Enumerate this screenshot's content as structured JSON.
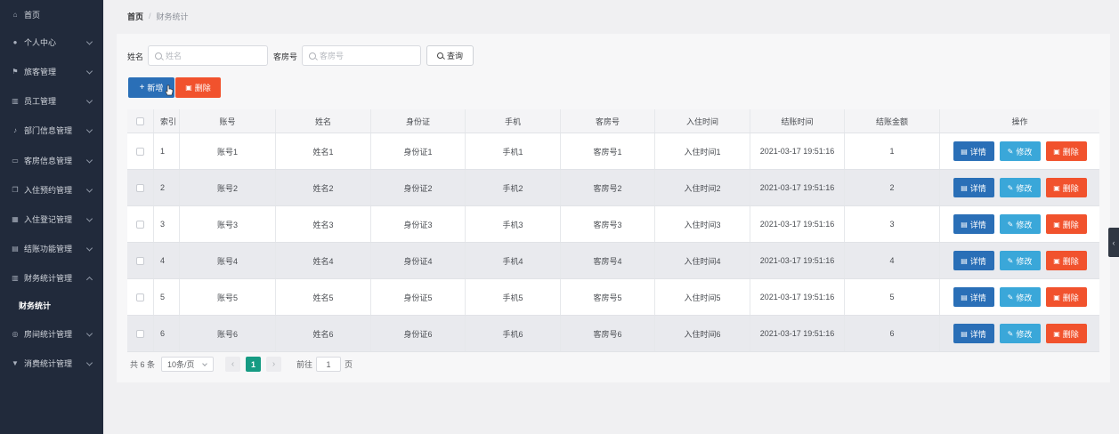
{
  "sidebar": {
    "items": [
      {
        "label": "首页",
        "icon": "home-icon",
        "glyph": "⌂",
        "expandable": false
      },
      {
        "label": "个人中心",
        "icon": "user-icon",
        "glyph": "●",
        "expandable": true
      },
      {
        "label": "旅客管理",
        "icon": "flag-icon",
        "glyph": "⚑",
        "expandable": true
      },
      {
        "label": "员工管理",
        "icon": "chart-bars-icon",
        "glyph": "▥",
        "expandable": true
      },
      {
        "label": "部门信息管理",
        "icon": "microphone-icon",
        "glyph": "♪",
        "expandable": true
      },
      {
        "label": "客房信息管理",
        "icon": "message-icon",
        "glyph": "▭",
        "expandable": true
      },
      {
        "label": "入住预约管理",
        "icon": "copy-icon",
        "glyph": "❐",
        "expandable": true
      },
      {
        "label": "入住登记管理",
        "icon": "grid-icon",
        "glyph": "▦",
        "expandable": true
      },
      {
        "label": "结账功能管理",
        "icon": "bag-icon",
        "glyph": "▤",
        "expandable": true
      },
      {
        "label": "财务统计管理",
        "icon": "trash-icon",
        "glyph": "▥",
        "expandable": true,
        "expanded": true
      },
      {
        "label": "房间统计管理",
        "icon": "globe-icon",
        "glyph": "◎",
        "expandable": true
      },
      {
        "label": "消费统计管理",
        "icon": "cup-icon",
        "glyph": "▼",
        "expandable": true
      }
    ],
    "sub_item": "财务统计"
  },
  "breadcrumb": {
    "home": "首页",
    "separator": "/",
    "current": "财务统计"
  },
  "search": {
    "name_label": "姓名",
    "name_placeholder": "姓名",
    "room_label": "客房号",
    "room_placeholder": "客房号",
    "query_label": "查询"
  },
  "actions": {
    "add_label": "新增",
    "delete_label": "删除"
  },
  "table": {
    "headers": [
      "索引",
      "账号",
      "姓名",
      "身份证",
      "手机",
      "客房号",
      "入住时间",
      "结账时间",
      "结账金额",
      "操作"
    ],
    "rows": [
      {
        "index": "1",
        "account": "账号1",
        "name": "姓名1",
        "idcard": "身份证1",
        "phone": "手机1",
        "room": "客房号1",
        "checkin": "入住时间1",
        "checkout": "2021-03-17 19:51:16",
        "amount": "1"
      },
      {
        "index": "2",
        "account": "账号2",
        "name": "姓名2",
        "idcard": "身份证2",
        "phone": "手机2",
        "room": "客房号2",
        "checkin": "入住时间2",
        "checkout": "2021-03-17 19:51:16",
        "amount": "2"
      },
      {
        "index": "3",
        "account": "账号3",
        "name": "姓名3",
        "idcard": "身份证3",
        "phone": "手机3",
        "room": "客房号3",
        "checkin": "入住时间3",
        "checkout": "2021-03-17 19:51:16",
        "amount": "3"
      },
      {
        "index": "4",
        "account": "账号4",
        "name": "姓名4",
        "idcard": "身份证4",
        "phone": "手机4",
        "room": "客房号4",
        "checkin": "入住时间4",
        "checkout": "2021-03-17 19:51:16",
        "amount": "4"
      },
      {
        "index": "5",
        "account": "账号5",
        "name": "姓名5",
        "idcard": "身份证5",
        "phone": "手机5",
        "room": "客房号5",
        "checkin": "入住时间5",
        "checkout": "2021-03-17 19:51:16",
        "amount": "5"
      },
      {
        "index": "6",
        "account": "账号6",
        "name": "姓名6",
        "idcard": "身份证6",
        "phone": "手机6",
        "room": "客房号6",
        "checkin": "入住时间6",
        "checkout": "2021-03-17 19:51:16",
        "amount": "6"
      }
    ],
    "op_labels": {
      "detail": "详情",
      "edit": "修改",
      "delete": "删除"
    }
  },
  "pagination": {
    "total_text": "共 6 条",
    "page_size": "10条/页",
    "prev": "‹",
    "current_page": "1",
    "next": "›",
    "goto_label": "前往",
    "goto_value": "1",
    "goto_suffix": "页"
  },
  "colors": {
    "sidebar_bg": "#212a3b",
    "primary": "#2a6fb7",
    "info": "#3aa7d9",
    "danger": "#f1522d",
    "page_active": "#169b83"
  }
}
